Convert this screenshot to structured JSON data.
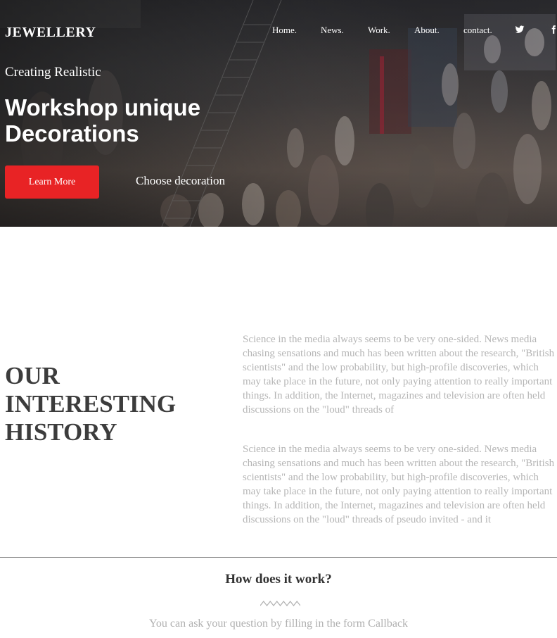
{
  "header": {
    "logo": "JEWELLERY",
    "nav": [
      "Home.",
      "News.",
      "Work.",
      "About.",
      "contact."
    ],
    "social_icons": [
      "twitter-icon",
      "facebook-icon"
    ]
  },
  "hero": {
    "pretitle": "Creating Realistic",
    "headline": "Workshop unique Decorations",
    "primary_button": "Learn More",
    "secondary_link": "Choose decoration",
    "accent_color": "#e82325"
  },
  "history": {
    "title": "OUR INTERESTING HISTORY",
    "paragraphs": [
      "Science in the media always seems to be very one-sided. News media chasing sensations and much has been written about the research, \"British scientists\" and the low probability, but high-profile discoveries, which may take place in the future, not only paying attention to really important things. In addition, the Internet, magazines and television are often held discussions on the \"loud\" threads of",
      "Science in the media always seems to be very one-sided. News media chasing sensations and much has been written about the research, \"British scientists\" and the low probability, but high-profile discoveries, which may take place in the future, not only paying attention to really important things. In addition, the Internet, magazines and television are often held discussions on the \"loud\" threads of pseudo invited - and it"
    ]
  },
  "how": {
    "title": "How does it work?",
    "subtitle": "You can ask your question by filling in the form Callback"
  }
}
